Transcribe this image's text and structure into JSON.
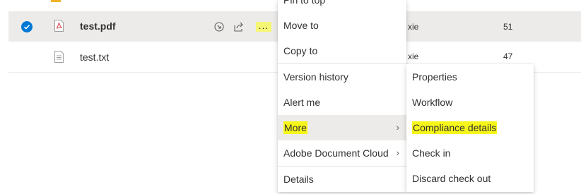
{
  "files": [
    {
      "name": "test.pdf",
      "author": "n xie",
      "size": "51",
      "selected": true,
      "type": "pdf"
    },
    {
      "name": "test.txt",
      "author": "n xie",
      "size": "47",
      "selected": false,
      "type": "txt"
    }
  ],
  "row_actions": {
    "more_label": "..."
  },
  "context_menu": {
    "items": [
      {
        "label": "Pin to top"
      },
      {
        "label": "Move to"
      },
      {
        "label": "Copy to"
      },
      {
        "label": "Version history"
      },
      {
        "label": "Alert me"
      },
      {
        "label": "More",
        "highlighted": true,
        "has_submenu": true
      },
      {
        "label": "Adobe Document Cloud",
        "has_submenu": true
      },
      {
        "label": "Details"
      }
    ]
  },
  "submenu": {
    "items": [
      {
        "label": "Properties"
      },
      {
        "label": "Workflow"
      },
      {
        "label": "Compliance details",
        "highlighted": true
      },
      {
        "label": "Check in"
      },
      {
        "label": "Discard check out"
      }
    ]
  },
  "colors": {
    "accent": "#0078d4",
    "highlight": "#f6f61a",
    "selected_row": "#edebe9"
  },
  "icons": [
    "checkmark-icon",
    "pdf-file-icon",
    "text-file-icon",
    "open-icon",
    "share-icon",
    "more-icon",
    "chevron-right-icon"
  ]
}
